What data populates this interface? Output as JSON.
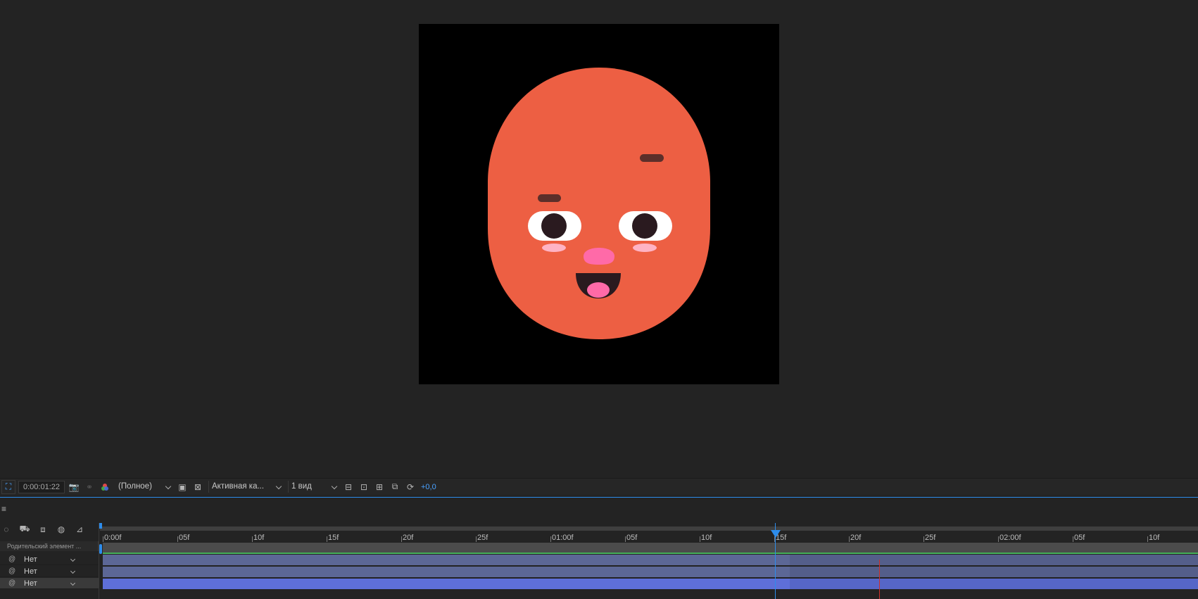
{
  "viewer": {
    "face": {
      "skin_color": "#ed5f43",
      "eye_white": "#ffffff",
      "pupil": "#2a1a1f",
      "brow": "#5c2f2a",
      "nose": "#ff6aa8",
      "cheek": "#ffb3c4",
      "mouth": "#2a1a1f",
      "tongue": "#ff6aa8"
    }
  },
  "toolbar": {
    "timecode": "0:00:01:22",
    "resolution": "(Полное)",
    "camera": "Активная ка...",
    "views": "1 вид",
    "exposure": "+0,0"
  },
  "timeline": {
    "menu_icon": "≡",
    "parent_header": "Родительский элемент ...",
    "layers": [
      {
        "parent": "Нет"
      },
      {
        "parent": "Нет"
      },
      {
        "parent": "Нет"
      }
    ],
    "ruler_labels": [
      "0:00f",
      "05f",
      "10f",
      "15f",
      "20f",
      "25f",
      "01:00f",
      "05f",
      "10f",
      "15f",
      "20f",
      "25f",
      "02:00f",
      "05f",
      "10f"
    ],
    "accent_color": "#2d8ceb"
  }
}
